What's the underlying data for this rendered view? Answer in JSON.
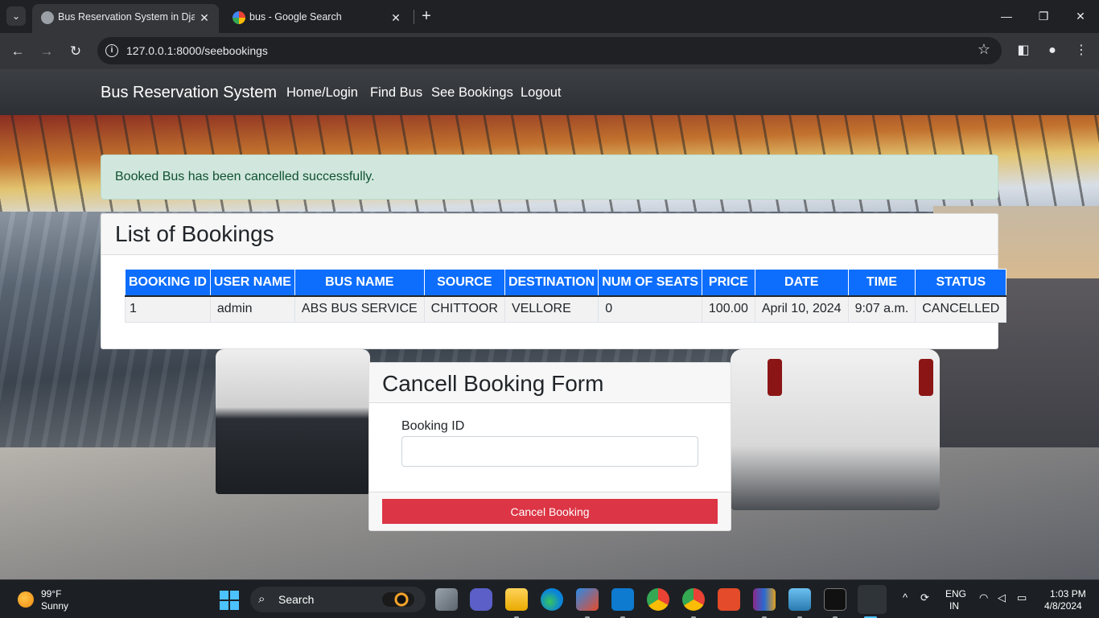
{
  "browser": {
    "tabs": [
      {
        "title": "Bus Reservation System in Djan",
        "active": true
      },
      {
        "title": "bus - Google Search",
        "active": false
      }
    ],
    "url": "127.0.0.1:8000/seebookings"
  },
  "navbar": {
    "brand": "Bus Reservation System",
    "links": [
      "Home/Login",
      "Find Bus",
      "See Bookings",
      "Logout"
    ]
  },
  "alert": {
    "message": "Booked Bus has been cancelled successfully."
  },
  "bookings": {
    "title": "List of Bookings",
    "columns": [
      "BOOKING ID",
      "USER NAME",
      "BUS NAME",
      "SOURCE",
      "DESTINATION",
      "NUM OF SEATS",
      "PRICE",
      "DATE",
      "TIME",
      "STATUS"
    ],
    "rows": [
      [
        "1",
        "admin",
        "ABS BUS SERVICE",
        "CHITTOOR",
        "VELLORE",
        "0",
        "100.00",
        "April 10, 2024",
        "9:07 a.m.",
        "CANCELLED"
      ]
    ]
  },
  "cancel_form": {
    "title": "Cancell Booking Form",
    "field_label": "Booking ID",
    "field_value": "",
    "button_label": "Cancel Booking"
  },
  "taskbar": {
    "weather_temp": "99°F",
    "weather_cond": "Sunny",
    "search_label": "Search",
    "lang_top": "ENG",
    "lang_bottom": "IN",
    "time": "1:03 PM",
    "date": "4/8/2024"
  },
  "colors": {
    "primary": "#0d6efd",
    "danger": "#dc3545",
    "success_bg": "#d1e7dd",
    "success_text": "#0f5132"
  }
}
